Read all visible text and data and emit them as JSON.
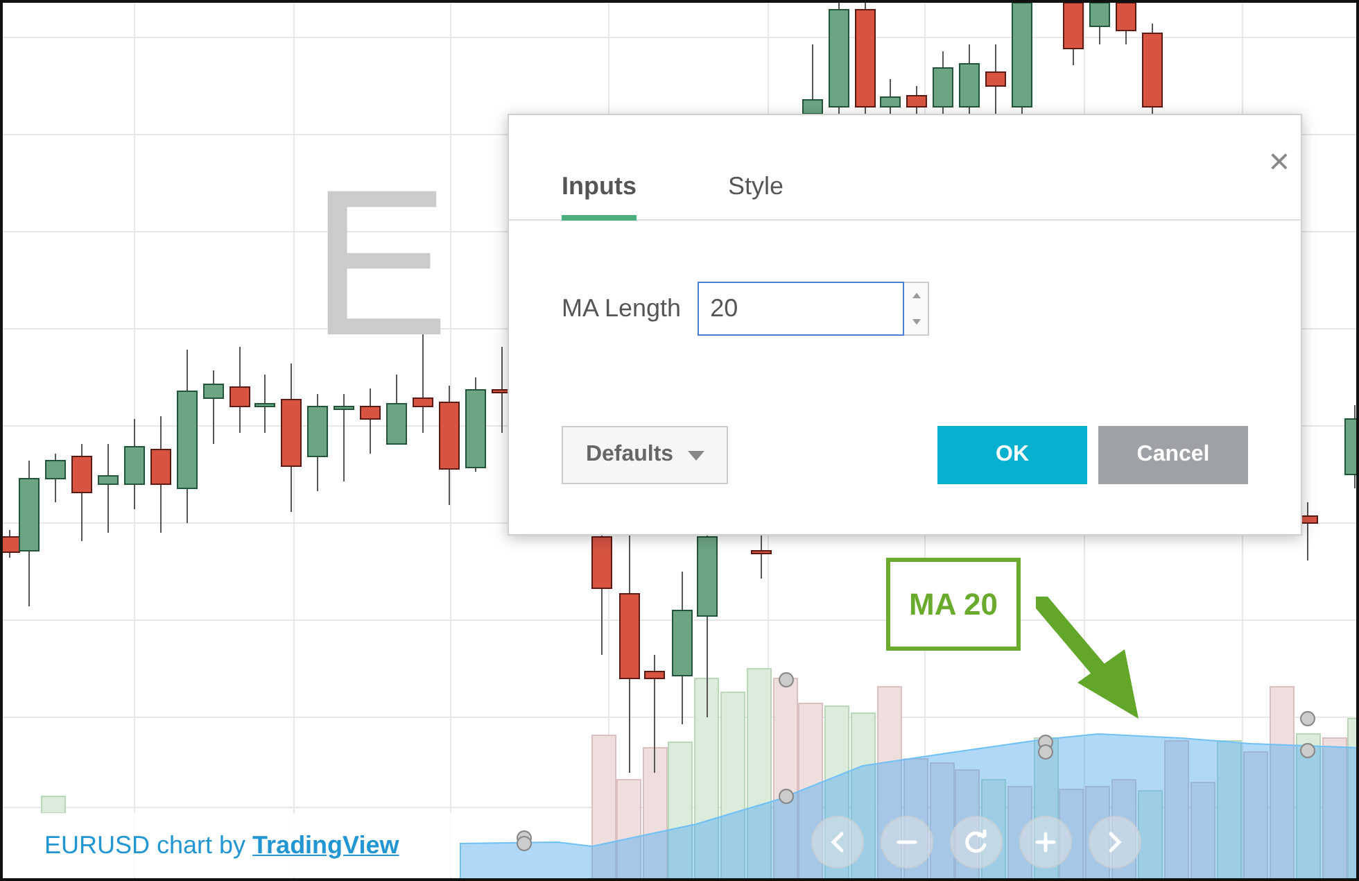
{
  "chart": {
    "watermark": "E",
    "attribution": {
      "prefix": "EURUSD chart by",
      "link": "TradingView"
    },
    "nav_buttons": [
      {
        "kind": "prev"
      },
      {
        "kind": "zoom_out"
      },
      {
        "kind": "reset"
      },
      {
        "kind": "zoom_in"
      },
      {
        "kind": "next"
      }
    ]
  },
  "dialog": {
    "tabs": [
      {
        "label": "Inputs",
        "selected": true
      },
      {
        "label": "Style",
        "selected": false
      }
    ],
    "close": "×",
    "fields": [
      {
        "label": "MA Length",
        "value": "20"
      }
    ],
    "defaults_button": "Defaults",
    "buttons": [
      {
        "label": "OK",
        "kind": "primary"
      },
      {
        "label": "Cancel",
        "kind": "secondary"
      }
    ]
  },
  "callout": {
    "label": "MA 20"
  }
}
